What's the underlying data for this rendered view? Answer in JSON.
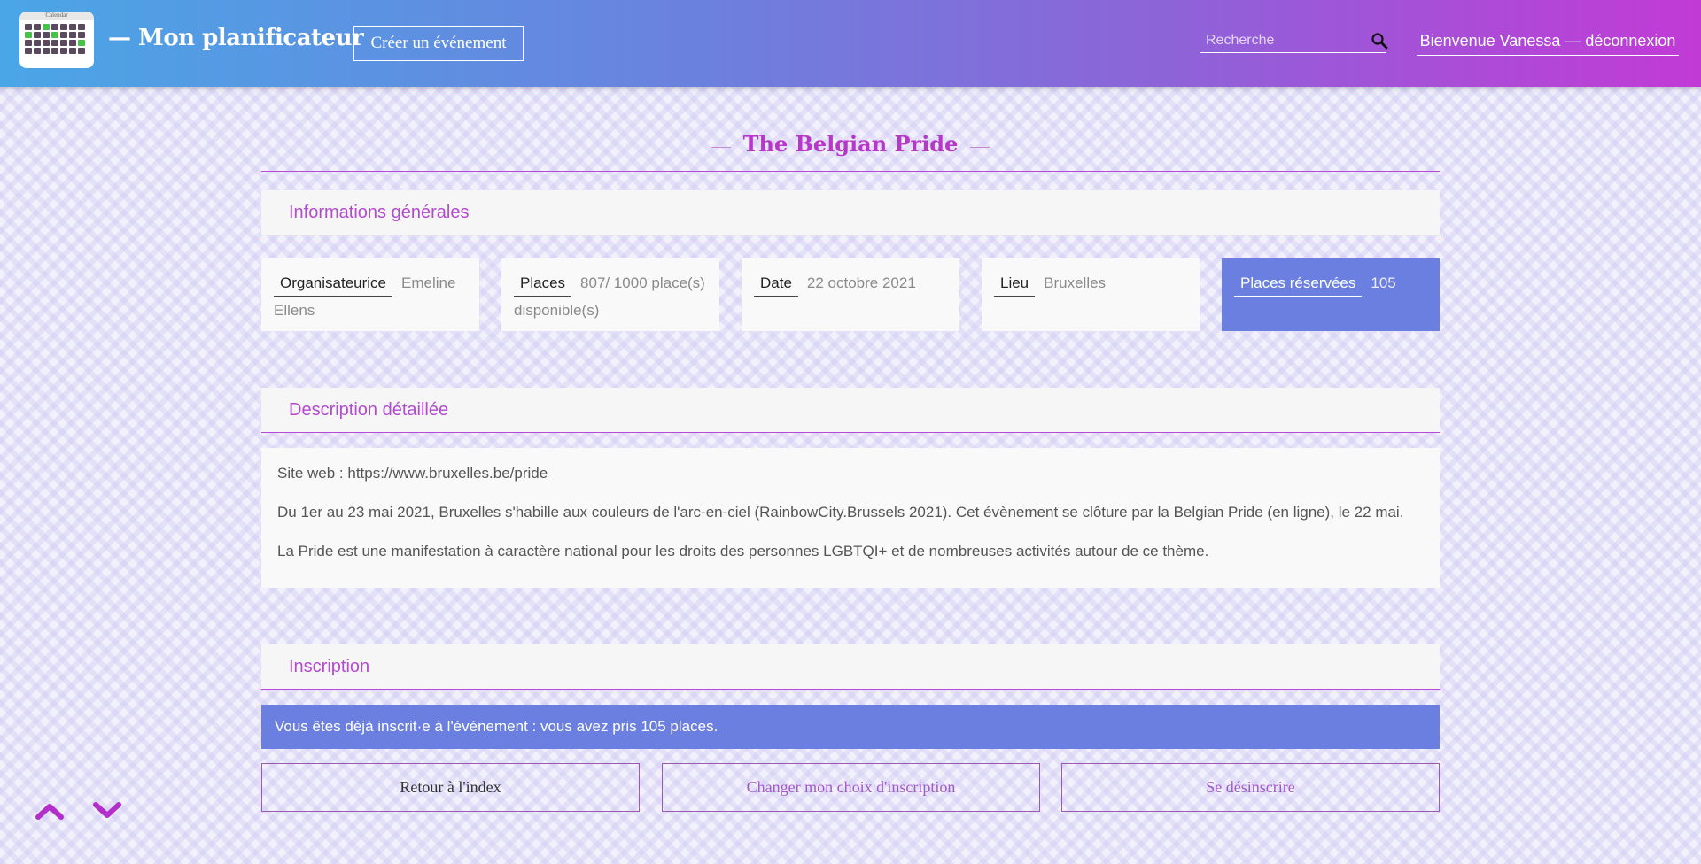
{
  "header": {
    "brand": "— Mon planificateur",
    "create_button": "Créer un événement",
    "search_placeholder": "Recherche",
    "welcome": "Bienvenue Vanessa — déconnexion",
    "logo_caption": "Calendar"
  },
  "event": {
    "title": "The Belgian Pride"
  },
  "general": {
    "heading": "Informations générales",
    "organizer_label": "Organisateurice",
    "organizer_value": "Emeline Ellens",
    "places_label": "Places",
    "places_value": "807/ 1000 place(s) disponible(s)",
    "date_label": "Date",
    "date_value": "22 octobre 2021",
    "location_label": "Lieu",
    "location_value": "Bruxelles",
    "reserved_label": "Places réservées",
    "reserved_value": "105"
  },
  "description": {
    "heading": "Description détaillée",
    "paragraphs": [
      "Site web : https://www.bruxelles.be/pride",
      "Du 1er au 23 mai 2021, Bruxelles s'habille aux couleurs de l'arc-en-ciel (RainbowCity.Brussels 2021). Cet évènement se clôture par la Belgian Pride (en ligne), le 22 mai.",
      "La Pride est une manifestation à caractère national pour les droits des personnes LGBTQI+ et de nombreuses activités autour de ce thème."
    ]
  },
  "inscription": {
    "heading": "Inscription",
    "notice": "Vous êtes déjà inscrit·e à l'événement : vous avez pris 105 places.",
    "back_button": "Retour à l'index",
    "change_button": "Changer mon choix d'inscription",
    "unsubscribe_button": "Se désinscrire"
  },
  "colors": {
    "accent": "#b737c9",
    "blue": "#6a7fe0"
  },
  "icons": {
    "search": "search-icon",
    "up": "chevron-up-icon",
    "down": "chevron-down-icon"
  }
}
